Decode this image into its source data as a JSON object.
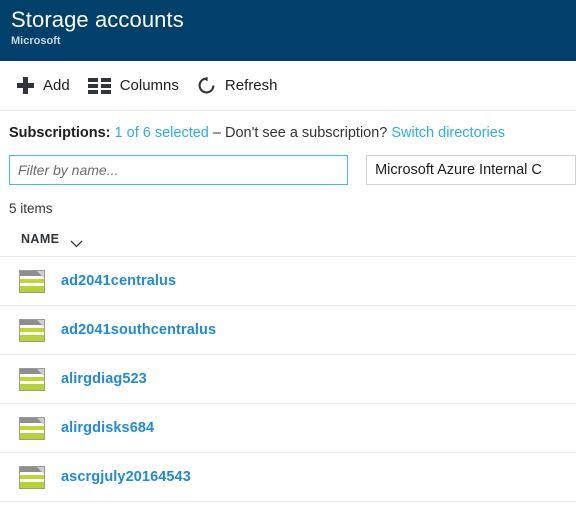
{
  "header": {
    "title": "Storage accounts",
    "subtitle": "Microsoft",
    "background_color": "#01406b"
  },
  "toolbar": {
    "buttons": [
      {
        "label": "Add",
        "icon": "plus-icon"
      },
      {
        "label": "Columns",
        "icon": "columns-icon"
      },
      {
        "label": "Refresh",
        "icon": "refresh-icon"
      }
    ]
  },
  "subscriptions": {
    "label": "Subscriptions:",
    "selected_link": "1 of 6 selected",
    "separator": " – Don't see a subscription? ",
    "switch_link": "Switch directories",
    "link_color": "#2aaee6"
  },
  "filter": {
    "placeholder": "Filter by name...",
    "value": "",
    "border_color": "#3fbeec"
  },
  "subscription_select": {
    "value": "Microsoft Azure Internal C"
  },
  "list": {
    "items_count": "5 items",
    "column_header": "NAME",
    "sort_icon": "chevron-down-icon",
    "rows": [
      {
        "name": "ad2041centralus",
        "icon": "storage-account-icon"
      },
      {
        "name": "ad2041southcentralus",
        "icon": "storage-account-icon"
      },
      {
        "name": "alirgdiag523",
        "icon": "storage-account-icon"
      },
      {
        "name": "alirgdisks684",
        "icon": "storage-account-icon"
      },
      {
        "name": "ascrgjuly20164543",
        "icon": "storage-account-icon"
      }
    ],
    "link_color": "#1f8bd8"
  }
}
